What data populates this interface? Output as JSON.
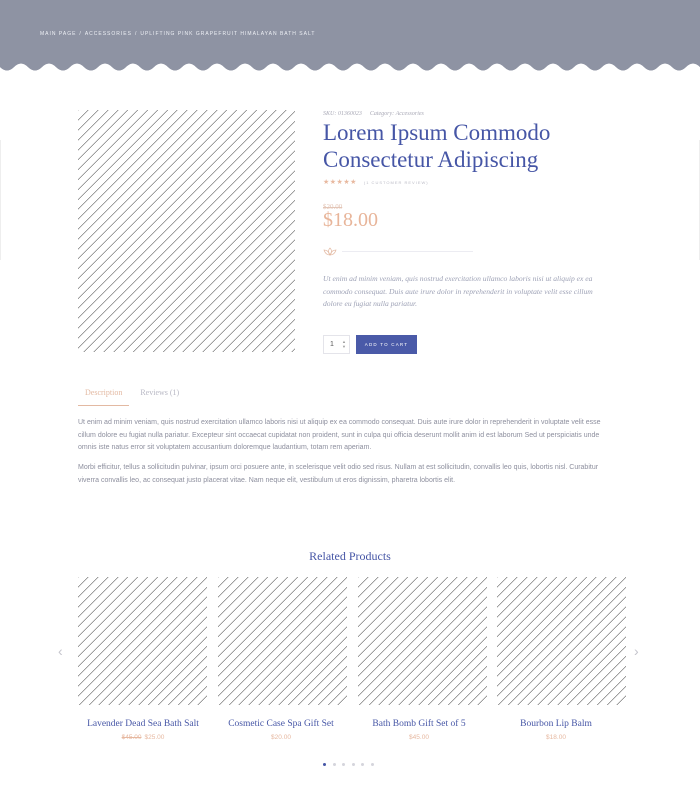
{
  "breadcrumb": {
    "items": [
      "MAIN PAGE",
      "ACCESSORIES",
      "UPLIFTING PINK GRAPEFRUIT HIMALAYAN BATH SALT"
    ],
    "separator": "/"
  },
  "product": {
    "sku_text": "SKU: 01360023",
    "category_text": "Category: Accessories",
    "title": "Lorem Ipsum Commodo Consectetur Adipiscing",
    "stars": "★★★★★",
    "rating_fraction": 1.0,
    "reviews_text": "(1 CUSTOMER REVIEW)",
    "old_price": "$20.00",
    "price": "$18.00",
    "description": "Ut enim ad minim veniam, quis nostrud exercitation ullamco laboris nisi ut aliquip ex ea commodo consequat. Duis aute irure dolor in reprehenderit in voluptate velit esse cillum dolore eu fugiat nulla pariatur.",
    "quantity": "1",
    "add_to_cart_label": "ADD TO CART"
  },
  "tabs": [
    {
      "label": "Description",
      "active": true
    },
    {
      "label": "Reviews (1)",
      "active": false
    }
  ],
  "tab_content": {
    "paragraph1": "Ut enim ad minim veniam, quis nostrud exercitation ullamco laboris nisi ut aliquip ex ea commodo consequat. Duis aute irure dolor in reprehenderit in voluptate velit esse cillum dolore eu fugiat nulla pariatur. Excepteur sint occaecat cupidatat non proident, sunt in culpa qui officia deserunt mollit anim id est laborum Sed ut perspiciatis unde omnis iste natus error sit voluptatem accusantium doloremque laudantium, totam rem aperiam.",
    "paragraph2": "Morbi efficitur, tellus a sollicitudin pulvinar, ipsum orci posuere ante, in scelerisque velit odio sed risus. Nullam at est sollicitudin, convallis leo quis, lobortis nisl. Curabitur viverra convallis leo, ac consequat justo placerat vitae. Nam neque elit, vestibulum ut eros dignissim, pharetra lobortis elit."
  },
  "related": {
    "title": "Related Products",
    "products": [
      {
        "name": "Lavender Dead Sea Bath Salt",
        "old_price": "$45.00",
        "price": "$25.00"
      },
      {
        "name": "Cosmetic Case Spa Gift Set",
        "old_price": "",
        "price": "$20.00"
      },
      {
        "name": "Bath Bomb Gift Set of 5",
        "old_price": "",
        "price": "$45.00"
      },
      {
        "name": "Bourbon Lip Balm",
        "old_price": "",
        "price": "$18.00"
      }
    ],
    "prev_icon": "‹",
    "next_icon": "›",
    "dot_count": 6,
    "active_dot": 1
  },
  "colors": {
    "accent_blue": "#4656a6",
    "header_gray": "#8e93a3",
    "peach": "#e8b59a"
  }
}
